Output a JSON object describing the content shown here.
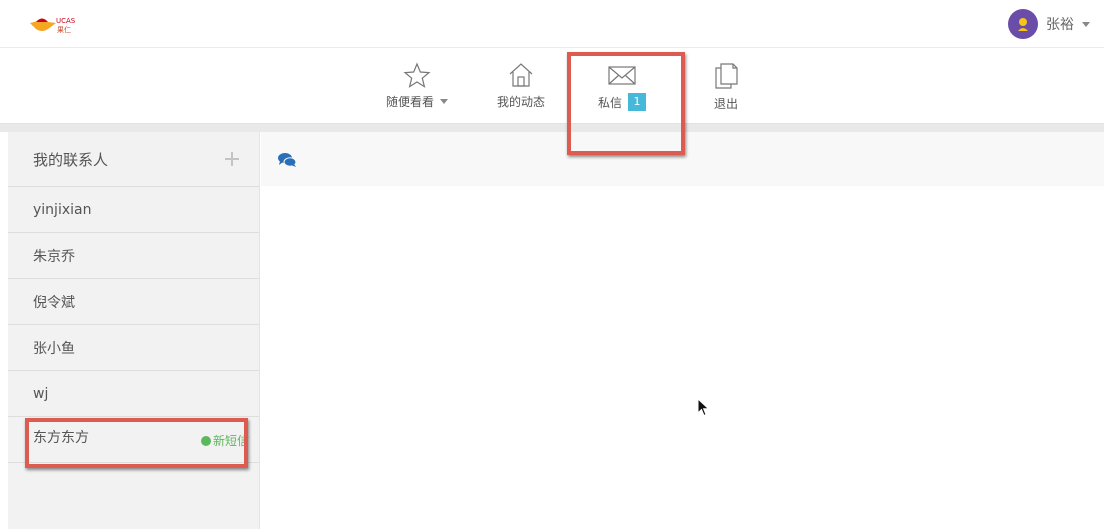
{
  "header": {
    "logo_icon": "ucas-logo-icon",
    "user_name": "张裕",
    "avatar_color": "#6a4da8"
  },
  "nav": {
    "items": [
      {
        "label": "随便看看",
        "icon": "star-icon",
        "has_dropdown": true
      },
      {
        "label": "我的动态",
        "icon": "home-icon"
      },
      {
        "label": "私信",
        "icon": "envelope-icon",
        "badge": "1"
      },
      {
        "label": "退出",
        "icon": "document-icon"
      }
    ]
  },
  "sidebar": {
    "title": "我的联系人",
    "contacts": [
      {
        "name": "yinjixian"
      },
      {
        "name": "朱京乔"
      },
      {
        "name": "倪令斌"
      },
      {
        "name": "张小鱼"
      },
      {
        "name": "wj"
      },
      {
        "name": "东方东方",
        "status": "新短信"
      }
    ]
  },
  "main": {
    "header_icon": "chat-bubbles-icon"
  },
  "colors": {
    "badge": "#46b8da",
    "new_message": "#5cb85c",
    "highlight": "#de5b4f"
  }
}
